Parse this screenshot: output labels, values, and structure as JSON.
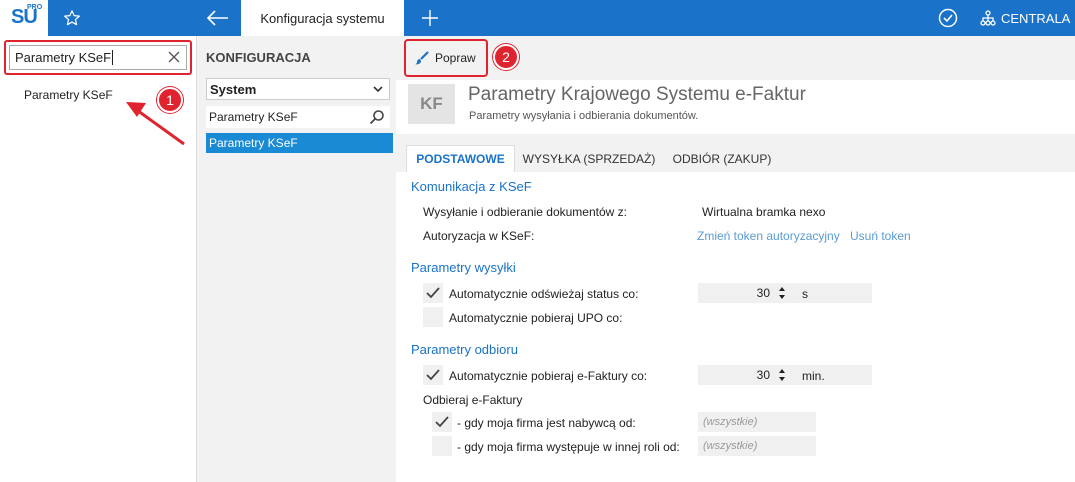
{
  "topbar": {
    "logo": "SU",
    "logo_sup": "PRO",
    "active_tab": "Konfiguracja systemu",
    "centrala": "CENTRALA",
    "icons": [
      "star-icon",
      "back-arrow-icon",
      "plus-icon",
      "check-circle-icon",
      "hierarchy-icon"
    ]
  },
  "search": {
    "value": "Parametry KSeF",
    "result": "Parametry KSeF"
  },
  "badges": {
    "one": "1",
    "two": "2"
  },
  "middle": {
    "title": "KONFIGURACJA",
    "select_value": "System",
    "filter_value": "Parametry KSeF",
    "selected_item": "Parametry KSeF"
  },
  "toolbar": {
    "popraw": "Popraw"
  },
  "header": {
    "badge": "KF",
    "title": "Parametry Krajowego Systemu e-Faktur",
    "subtitle": "Parametry wysyłania i odbierania dokumentów."
  },
  "tabs": [
    "PODSTAWOWE",
    "WYSYŁKA (SPRZEDAŻ)",
    "ODBIÓR (ZAKUP)"
  ],
  "komunikacja": {
    "title": "Komunikacja z KSeF",
    "row1_label": "Wysyłanie i odbieranie dokumentów z:",
    "row1_value": "Wirtualna bramka nexo",
    "row2_label": "Autoryzacja w KSeF:",
    "link1": "Zmień token autoryzacyjny",
    "link2": "Usuń token"
  },
  "wysylka": {
    "title": "Parametry wysyłki",
    "status_label": "Automatycznie odświeżaj status co:",
    "status_checked": true,
    "status_value": "30",
    "status_unit": "s",
    "upo_label": "Automatycznie pobieraj UPO co:",
    "upo_checked": false
  },
  "odbior": {
    "title": "Parametry odbioru",
    "pobieraj_label": "Automatycznie pobieraj e-Faktury co:",
    "pobieraj_checked": true,
    "pobieraj_value": "30",
    "pobieraj_unit": "min.",
    "odbieraj_label": "Odbieraj e-Faktury",
    "nabywca_label": "- gdy moja firma jest nabywcą od:",
    "nabywca_checked": true,
    "nabywca_placeholder": "(wszystkie)",
    "inna_rola_label": "- gdy moja firma występuje w innej roli od:",
    "inna_rola_checked": false,
    "inna_rola_placeholder": "(wszystkie)"
  }
}
